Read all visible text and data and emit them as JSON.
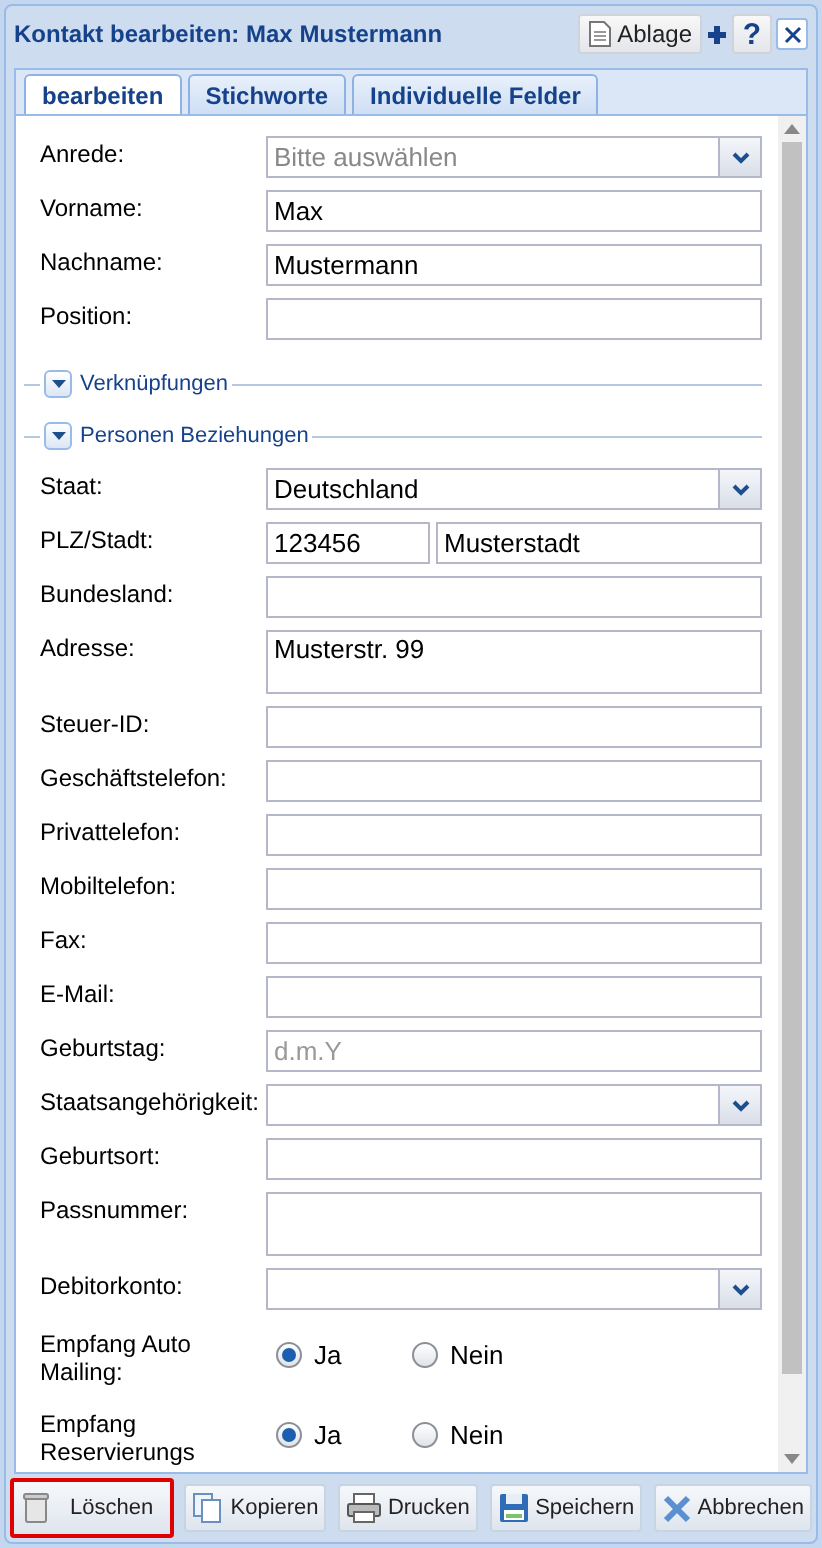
{
  "window": {
    "title": "Kontakt bearbeiten: Max Mustermann"
  },
  "header_buttons": [
    {
      "kind": "ablage",
      "label": "Ablage"
    },
    {
      "kind": "plus"
    },
    {
      "kind": "help",
      "label": "?"
    },
    {
      "kind": "close"
    }
  ],
  "tabs": [
    {
      "label": "bearbeiten",
      "selected": true
    },
    {
      "label": "Stichworte",
      "selected": false
    },
    {
      "label": "Individuelle Felder",
      "selected": false
    }
  ],
  "rows": [
    {
      "kind": "select",
      "label": "Anrede:",
      "placeholder": "Bitte auswählen"
    },
    {
      "kind": "text",
      "label": "Vorname:",
      "value": "Max"
    },
    {
      "kind": "text",
      "label": "Nachname:",
      "value": "Mustermann"
    },
    {
      "kind": "text",
      "label": "Position:"
    },
    {
      "kind": "section",
      "label": "Verknüpfungen",
      "expanded": false
    },
    {
      "kind": "section",
      "label": "Personen Beziehungen",
      "expanded": false
    },
    {
      "kind": "select",
      "label": "Staat:",
      "value": "Deutschland"
    },
    {
      "kind": "pair",
      "label": "PLZ/Stadt:",
      "value": "123456",
      "value2": "Musterstadt"
    },
    {
      "kind": "text",
      "label": "Bundesland:"
    },
    {
      "kind": "textarea",
      "label": "Adresse:",
      "value": "Musterstr. 99"
    },
    {
      "kind": "text",
      "label": "Steuer-ID:"
    },
    {
      "kind": "text",
      "label": "Geschäftstelefon:"
    },
    {
      "kind": "text",
      "label": "Privattelefon:"
    },
    {
      "kind": "text",
      "label": "Mobiltelefon:"
    },
    {
      "kind": "text",
      "label": "Fax:"
    },
    {
      "kind": "text",
      "label": "E-Mail:"
    },
    {
      "kind": "text",
      "label": "Geburtstag:",
      "placeholder": "d.m.Y"
    },
    {
      "kind": "select",
      "label": "Staatsangehörigkeit:"
    },
    {
      "kind": "text",
      "label": "Geburtsort:"
    },
    {
      "kind": "textarea",
      "label": "Passnummer:"
    },
    {
      "kind": "select",
      "label": "Debitorkonto:"
    },
    {
      "kind": "radio",
      "label": "Empfang Auto Mailing:",
      "options": [
        {
          "label": "Ja",
          "selected": true
        },
        {
          "label": "Nein",
          "selected": false
        }
      ]
    },
    {
      "kind": "radio",
      "label": "Empfang Reservierungs",
      "options": [
        {
          "label": "Ja",
          "selected": true
        },
        {
          "label": "Nein",
          "selected": false
        }
      ]
    }
  ],
  "footer_buttons": [
    {
      "kind": "delete",
      "label": "Löschen",
      "highlighted": true
    },
    {
      "kind": "copy",
      "label": "Kopieren",
      "highlighted": false
    },
    {
      "kind": "print",
      "label": "Drucken",
      "highlighted": false
    },
    {
      "kind": "save",
      "label": "Speichern",
      "highlighted": false
    },
    {
      "kind": "cancel",
      "label": "Abbrechen",
      "highlighted": false
    }
  ]
}
